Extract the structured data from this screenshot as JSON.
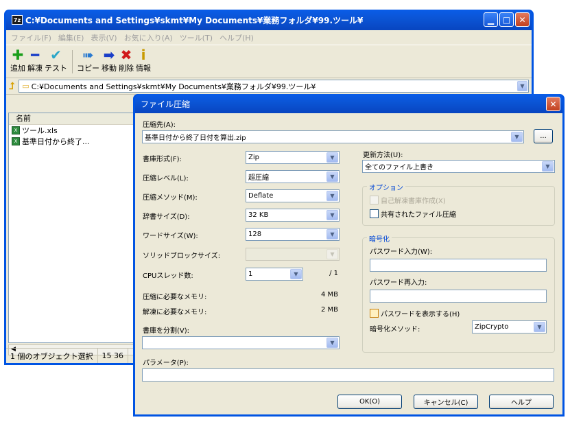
{
  "main_window": {
    "title": "C:¥Documents and Settings¥skmt¥My Documents¥業務フォルダ¥99.ツール¥",
    "app_icon": "7z",
    "menu": [
      "ファイル(F)",
      "編集(E)",
      "表示(V)",
      "お気に入り(A)",
      "ツール(T)",
      "ヘルプ(H)"
    ],
    "toolbar": [
      {
        "label": "追加",
        "icon": "plus-icon",
        "glyph": "✚",
        "color": "#1a9e1a"
      },
      {
        "label": "解凍",
        "icon": "minus-icon",
        "glyph": "━",
        "color": "#1a3ec8"
      },
      {
        "label": "テスト",
        "icon": "check-icon",
        "glyph": "✔",
        "color": "#2aa6c8"
      },
      {
        "label": "コピー",
        "icon": "copy-arrow-icon",
        "glyph": "➠",
        "color": "#2a7ad0"
      },
      {
        "label": "移動",
        "icon": "move-arrow-icon",
        "glyph": "➡",
        "color": "#1a3ec8"
      },
      {
        "label": "削除",
        "icon": "delete-x-icon",
        "glyph": "✖",
        "color": "#d01a1a"
      },
      {
        "label": "情報",
        "icon": "info-icon",
        "glyph": "i",
        "color": "#c89a00"
      }
    ],
    "address": "C:¥Documents and Settings¥skmt¥My Documents¥業務フォルダ¥99.ツール¥",
    "list_header": "名前",
    "files": [
      "ツール.xls",
      "基準日付から終了..."
    ],
    "status": [
      "1 個のオブジェクト選択",
      "15 36"
    ]
  },
  "dialog": {
    "title": "ファイル圧縮",
    "archive_label": "圧縮先(A):",
    "archive_value": "基準日付から終了日付を算出.zip",
    "browse": "...",
    "format_label": "書庫形式(F):",
    "format_value": "Zip",
    "level_label": "圧縮レベル(L):",
    "level_value": "超圧縮",
    "method_label": "圧縮メソッド(M):",
    "method_value": "Deflate",
    "dict_label": "辞書サイズ(D):",
    "dict_value": "32 KB",
    "word_label": "ワードサイズ(W):",
    "word_value": "128",
    "solid_label": "ソリッドブロックサイズ:",
    "cpu_label": "CPUスレッド数:",
    "cpu_value": "1",
    "cpu_max": "/ 1",
    "mem_comp_label": "圧縮に必要なメモリ:",
    "mem_comp_value": "4 MB",
    "mem_decomp_label": "解凍に必要なメモリ:",
    "mem_decomp_value": "2 MB",
    "split_label": "書庫を分割(V):",
    "params_label": "パラメータ(P):",
    "update_label": "更新方法(U):",
    "update_value": "全てのファイル上書き",
    "options_title": "オプション",
    "sfx_label": "自己解凍書庫作成(X)",
    "shared_label": "共有されたファイル圧縮",
    "encrypt_title": "暗号化",
    "pwd_label": "パスワード入力(W):",
    "pwd2_label": "パスワード再入力:",
    "show_pwd_label": "パスワードを表示する(H)",
    "enc_method_label": "暗号化メソッド:",
    "enc_method_value": "ZipCrypto",
    "ok": "OK(O)",
    "cancel": "キャンセル(C)",
    "help": "ヘルプ"
  }
}
